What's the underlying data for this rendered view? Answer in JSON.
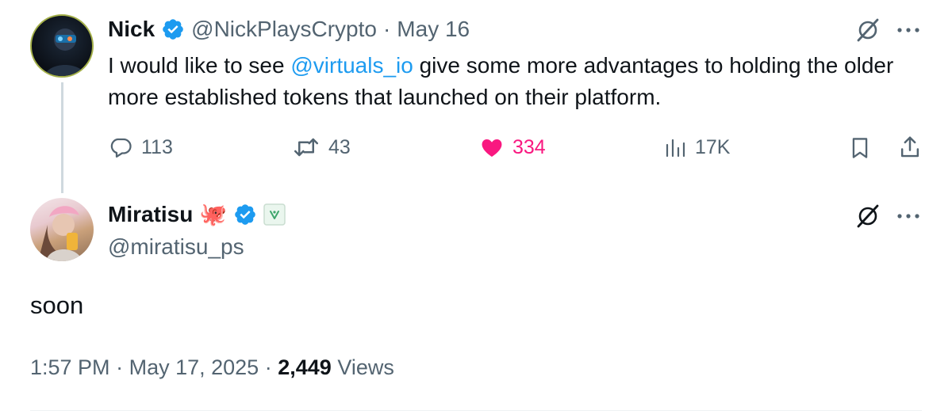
{
  "colors": {
    "verified_blue": "#1d9bf0",
    "like_pink": "#f91880",
    "secondary_text": "#536471",
    "primary_text": "#0f1419",
    "mention": "#1d9bf0"
  },
  "parent_tweet": {
    "author_name": "Nick",
    "handle": "@NickPlaysCrypto",
    "separator": "·",
    "date": "May 16",
    "text_before": "I would like to see ",
    "mention": "@virtuals_io",
    "text_after": " give some more advantages to holding the older more established tokens that launched on their platform.",
    "stats": {
      "replies": "113",
      "reposts": "43",
      "likes": "334",
      "views": "17K"
    },
    "icons": [
      "grok-icon",
      "more-icon",
      "reply-icon",
      "repost-icon",
      "heart-icon",
      "views-icon",
      "bookmark-icon",
      "share-icon"
    ]
  },
  "reply_tweet": {
    "author_name": "Miratisu",
    "emoji": "🐙",
    "handle": "@miratisu_ps",
    "text": "soon",
    "time": "1:57 PM",
    "separator": "·",
    "date": "May 17, 2025",
    "views_count": "2,449",
    "views_label": "Views",
    "icons": [
      "grok-icon",
      "more-icon",
      "verified-badge-icon",
      "affiliate-badge-icon"
    ]
  }
}
